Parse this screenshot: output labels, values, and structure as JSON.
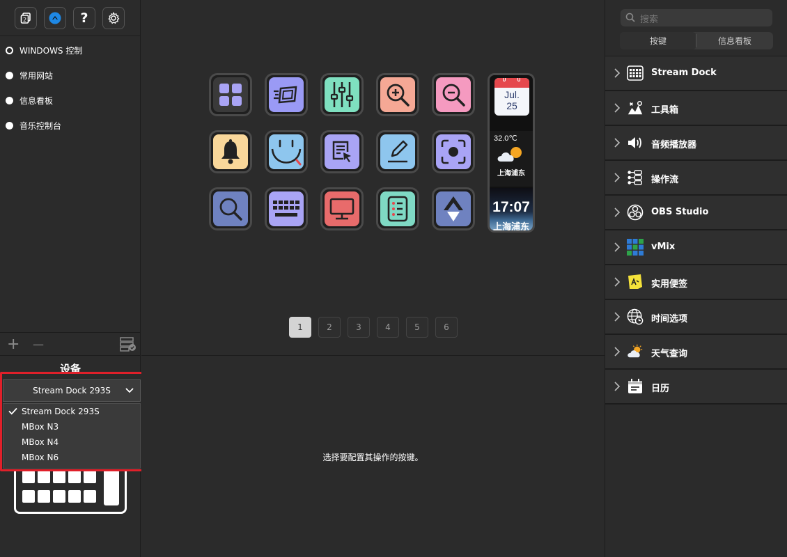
{
  "toolbar": {
    "icons": [
      "copy-icon",
      "stream-dock-logo-icon",
      "help-icon",
      "settings-icon"
    ],
    "help_label": "?"
  },
  "profiles": [
    {
      "label": "WINDOWS 控制",
      "active": true
    },
    {
      "label": "常用网站",
      "active": false
    },
    {
      "label": "信息看板",
      "active": false
    },
    {
      "label": "音乐控制台",
      "active": false
    }
  ],
  "left_actions": {
    "add_label": "+",
    "remove_label": "—"
  },
  "device": {
    "title": "设备",
    "selected": "Stream Dock 293S",
    "options": [
      "Stream Dock 293S",
      "MBox N3",
      "MBox N4",
      "MBox N6"
    ]
  },
  "keys": [
    {
      "icon": "grid-icon",
      "color": "#3a3a3a"
    },
    {
      "icon": "fast-screen-icon",
      "color": "#9a9af5"
    },
    {
      "icon": "mixer-sliders-icon",
      "color": "#7fe0c0"
    },
    {
      "icon": "zoom-in-icon",
      "color": "#f5a895"
    },
    {
      "icon": "zoom-out-icon",
      "color": "#f59ac0"
    },
    {
      "icon": "bell-icon",
      "color": "#f9d79a"
    },
    {
      "icon": "smile-icon",
      "color": "#8ec6ee"
    },
    {
      "icon": "document-cursor-icon",
      "color": "#a9a4f5"
    },
    {
      "icon": "edit-pen-icon",
      "color": "#8ec6ee"
    },
    {
      "icon": "screenshot-icon",
      "color": "#a9a4f5"
    },
    {
      "icon": "search-icon",
      "color": "#6f82c0"
    },
    {
      "icon": "keyboard-icon",
      "color": "#a9a4f5"
    },
    {
      "icon": "monitor-icon",
      "color": "#e86b6b"
    },
    {
      "icon": "list-icon",
      "color": "#7fd9c4"
    },
    {
      "icon": "up-down-arrow-icon",
      "color": "#6f82c0"
    }
  ],
  "info_key": {
    "calendar_month": "Jul.",
    "calendar_day": "25",
    "temperature": "32.0℃",
    "weather_city": "上海浦东",
    "time": "17:07",
    "time_city": "上海浦东"
  },
  "pager": {
    "pages": [
      "1",
      "2",
      "3",
      "4",
      "5",
      "6"
    ],
    "active": "1"
  },
  "hint": "选择要配置其操作的按键。",
  "search": {
    "placeholder": "搜索"
  },
  "tabs": [
    {
      "label": "按键",
      "selected": true
    },
    {
      "label": "信息看板",
      "selected": false
    }
  ],
  "categories": [
    {
      "label": "Stream Dock",
      "icon": "stream-dock-icon"
    },
    {
      "label": "工具箱",
      "icon": "toolbox-icon"
    },
    {
      "label": "音频播放器",
      "icon": "speaker-icon"
    },
    {
      "label": "操作流",
      "icon": "workflow-icon"
    },
    {
      "label": "OBS Studio",
      "icon": "obs-icon"
    },
    {
      "label": "vMix",
      "icon": "vmix-icon"
    },
    {
      "label": "实用便签",
      "icon": "sticky-note-icon"
    },
    {
      "label": "时间选项",
      "icon": "globe-clock-icon"
    },
    {
      "label": "天气查询",
      "icon": "weather-icon"
    },
    {
      "label": "日历",
      "icon": "calendar-icon"
    }
  ],
  "colors": {
    "accent_blue": "#1e88e5",
    "highlight_red": "#e0202a"
  }
}
